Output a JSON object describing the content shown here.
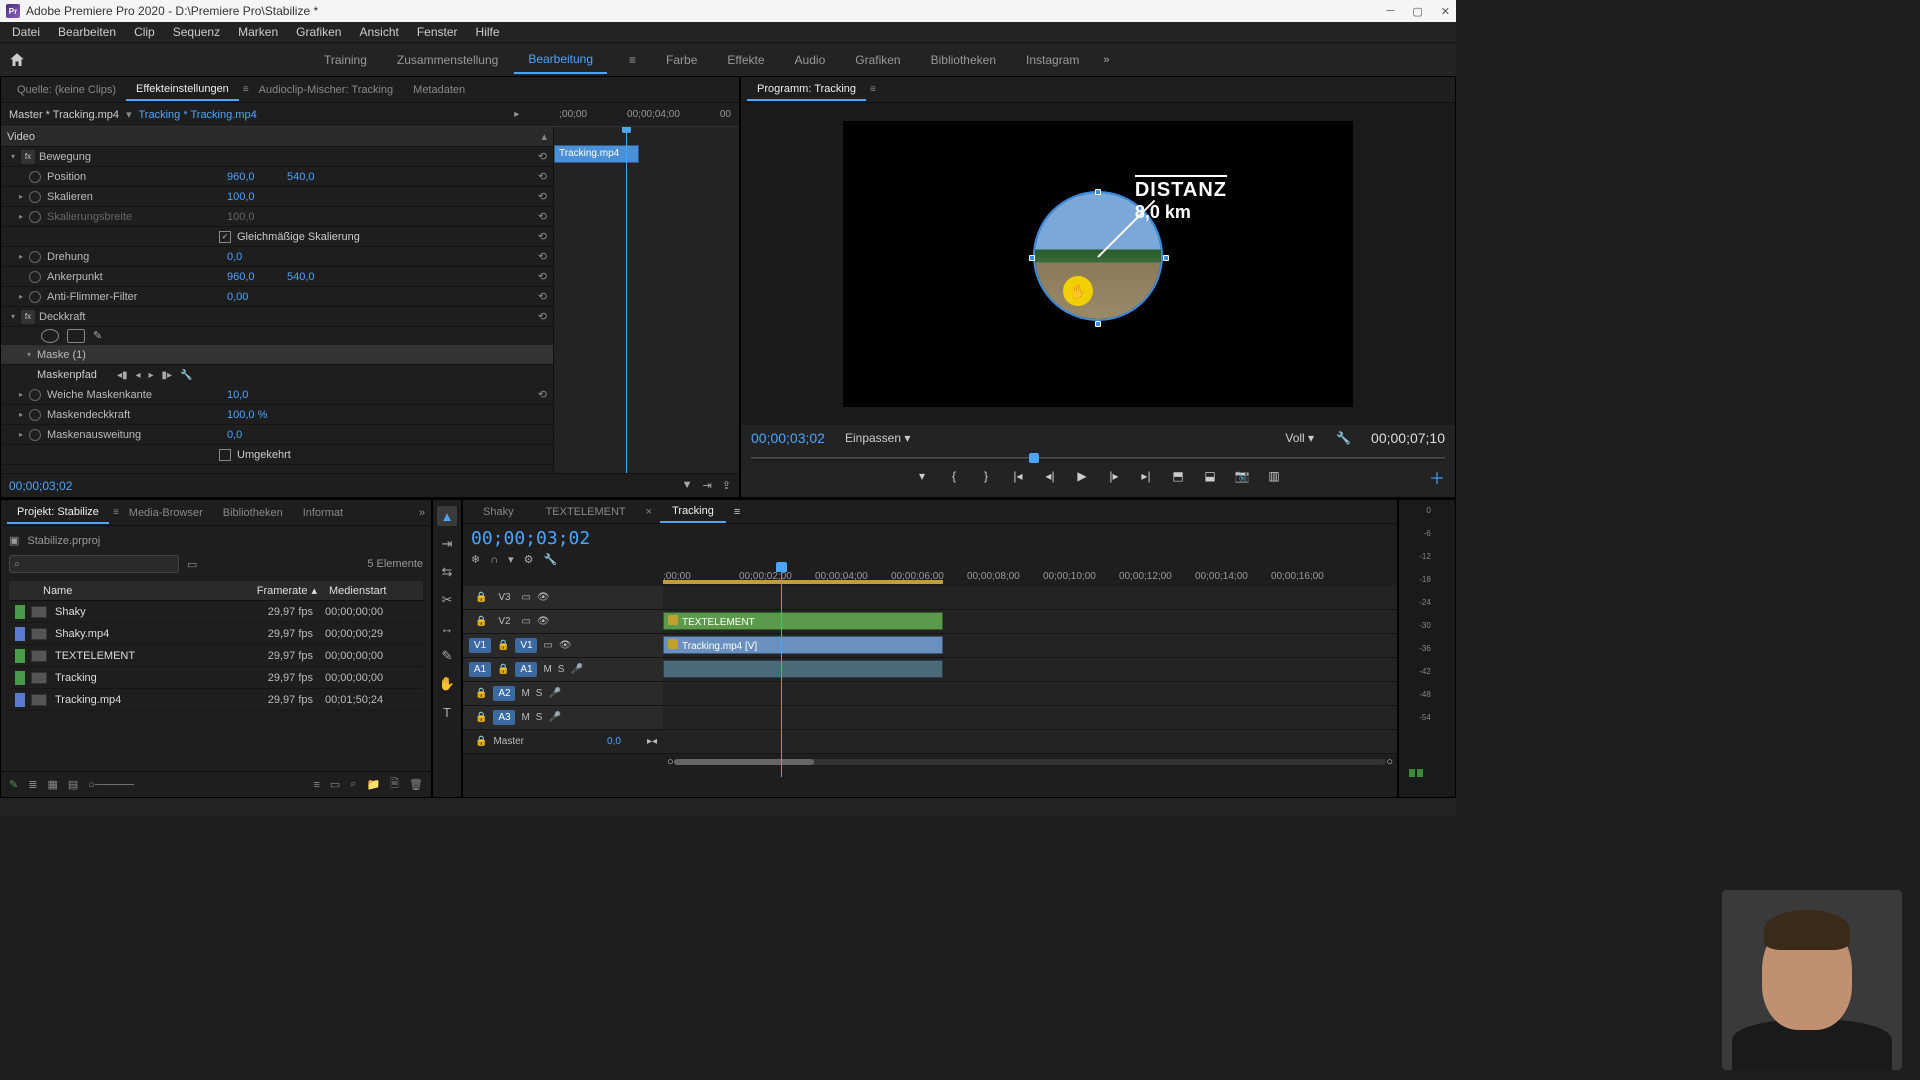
{
  "titlebar": {
    "text": "Adobe Premiere Pro 2020 - D:\\Premiere Pro\\Stabilize *"
  },
  "menu": [
    "Datei",
    "Bearbeiten",
    "Clip",
    "Sequenz",
    "Marken",
    "Grafiken",
    "Ansicht",
    "Fenster",
    "Hilfe"
  ],
  "workspaces": {
    "items": [
      "Training",
      "Zusammenstellung",
      "Bearbeitung",
      "Farbe",
      "Effekte",
      "Audio",
      "Grafiken",
      "Bibliotheken",
      "Instagram"
    ],
    "active": "Bearbeitung"
  },
  "source_tabs": {
    "items": [
      "Quelle: (keine Clips)",
      "Effekteinstellungen",
      "Audioclip-Mischer: Tracking",
      "Metadaten"
    ],
    "active": "Effekteinstellungen"
  },
  "effect_controls": {
    "master": "Master * Tracking.mp4",
    "clip_link": "Tracking * Tracking.mp4",
    "ruler": [
      ";00;00",
      "00;00;04;00",
      "00"
    ],
    "clip_name": "Tracking.mp4",
    "video_header": "Video",
    "bewegung": {
      "label": "Bewegung",
      "position": {
        "label": "Position",
        "x": "960,0",
        "y": "540,0"
      },
      "skalieren": {
        "label": "Skalieren",
        "v": "100,0"
      },
      "skalierungsbreite": {
        "label": "Skalierungsbreite",
        "v": "100,0"
      },
      "gleich": {
        "label": "Gleichmäßige Skalierung",
        "checked": true
      },
      "drehung": {
        "label": "Drehung",
        "v": "0,0"
      },
      "anker": {
        "label": "Ankerpunkt",
        "x": "960,0",
        "y": "540,0"
      },
      "aff": {
        "label": "Anti-Flimmer-Filter",
        "v": "0,00"
      }
    },
    "deckkraft": {
      "label": "Deckkraft",
      "maske": {
        "label": "Maske (1)"
      },
      "maskenpfad": {
        "label": "Maskenpfad"
      },
      "weiche": {
        "label": "Weiche Maskenkante",
        "v": "10,0"
      },
      "mdeck": {
        "label": "Maskendeckkraft",
        "v": "100,0 %"
      },
      "mausw": {
        "label": "Maskenausweitung",
        "v": "0,0"
      },
      "umgek": {
        "label": "Umgekehrt",
        "checked": false
      }
    },
    "footer_tc": "00;00;03;02"
  },
  "program": {
    "title": "Programm: Tracking",
    "overlay": {
      "line1": "DISTANZ",
      "line2": "8,0 km"
    },
    "tc_left": "00;00;03;02",
    "fit": "Einpassen",
    "zoom": "Voll",
    "tc_right": "00;00;07;10"
  },
  "project": {
    "tabs": [
      "Projekt: Stabilize",
      "Media-Browser",
      "Bibliotheken",
      "Informat"
    ],
    "filename": "Stabilize.prproj",
    "count": "5 Elemente",
    "cols": [
      "Name",
      "Framerate",
      "Medienstart"
    ],
    "items": [
      {
        "label": "green",
        "name": "Shaky",
        "fps": "29,97 fps",
        "start": "00;00;00;00"
      },
      {
        "label": "blue",
        "name": "Shaky.mp4",
        "fps": "29,97 fps",
        "start": "00;00;00;29"
      },
      {
        "label": "green",
        "name": "TEXTELEMENT",
        "fps": "29,97 fps",
        "start": "00;00;00;00"
      },
      {
        "label": "green",
        "name": "Tracking",
        "fps": "29,97 fps",
        "start": "00;00;00;00"
      },
      {
        "label": "blue",
        "name": "Tracking.mp4",
        "fps": "29,97 fps",
        "start": "00;01;50;24"
      }
    ]
  },
  "timeline": {
    "tabs": [
      "Shaky",
      "TEXTELEMENT",
      "Tracking"
    ],
    "active": "Tracking",
    "tc": "00;00;03;02",
    "ruler": [
      ";00;00",
      "00;00;02;00",
      "00;00;04;00",
      "00;00;06;00",
      "00;00;08;00",
      "00;00;10;00",
      "00;00;12;00",
      "00;00;14;00",
      "00;00;16;00"
    ],
    "tracks": {
      "v3": "V3",
      "v2": "V2",
      "v1": "V1",
      "a1": "A1",
      "a2": "A2",
      "a3": "A3",
      "src_v1": "V1",
      "src_a1": "A1",
      "master": "Master",
      "master_val": "0,0"
    },
    "clips": {
      "text": "TEXTELEMENT",
      "video": "Tracking.mp4 [V]"
    },
    "mute": "M",
    "solo": "S"
  },
  "meters_scale": [
    "0",
    "-6",
    "-12",
    "-18",
    "-24",
    "-30",
    "-36",
    "-42",
    "-48",
    "-54"
  ]
}
